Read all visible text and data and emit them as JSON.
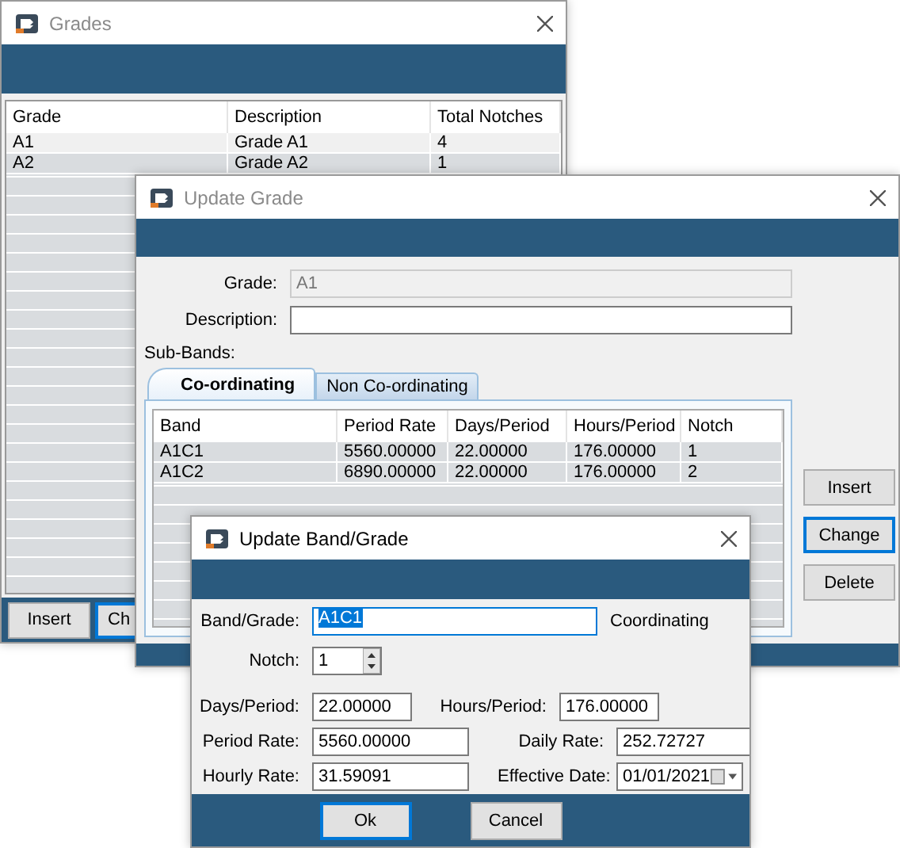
{
  "grades_window": {
    "title": "Grades",
    "columns": [
      "Grade",
      "Description",
      "Total Notches"
    ],
    "rows": [
      [
        "A1",
        "Grade A1",
        "4"
      ],
      [
        "A2",
        "Grade A2",
        "1"
      ]
    ],
    "buttons": [
      "Insert",
      "Ch"
    ]
  },
  "update_grade_window": {
    "title": "Update Grade",
    "fields": [
      {
        "label": "Grade:",
        "value": "A1",
        "disabled": true
      },
      {
        "label": "Description:",
        "disabled": false
      }
    ],
    "sub_bands_label": "Sub-Bands:",
    "tabs": [
      {
        "label": "Co-ordinating",
        "selected": true
      },
      {
        "label": "Non Co-ordinating",
        "selected": false
      }
    ],
    "columns": [
      "Band",
      "Period Rate",
      "Days/Period",
      "Hours/Period",
      "Notch"
    ],
    "rows": [
      [
        "A1C1",
        "5560.00000",
        "22.00000",
        "176.00000",
        "1"
      ],
      [
        "A1C2",
        "6890.00000",
        "22.00000",
        "176.00000",
        "2"
      ]
    ],
    "buttons": [
      {
        "label": "Insert",
        "focused": false
      },
      {
        "label": "Change",
        "focused": true
      },
      {
        "label": "Delete",
        "focused": false
      }
    ]
  },
  "band_window": {
    "title": "Update Band/Grade",
    "band_label": "Band/Grade:",
    "band_value": "A1C1",
    "band_type": "Coordinating",
    "notch_label": "Notch:",
    "notch_value": "1",
    "rows": [
      [
        {
          "label": "Days/Period:",
          "value": "22.00000"
        },
        {
          "label": "Hours/Period:",
          "value": "176.00000"
        }
      ],
      [
        {
          "label": "Period Rate:",
          "value": "5560.00000"
        },
        {
          "label": "Daily Rate:",
          "value": "252.72727"
        }
      ],
      [
        {
          "label": "Hourly Rate:",
          "value": "31.59091"
        },
        {
          "label": "Effective Date:",
          "value": "01/01/2021",
          "kind": "date"
        }
      ]
    ],
    "buttons": [
      {
        "label": "Ok",
        "focused": true
      },
      {
        "label": "Cancel",
        "focused": false
      }
    ]
  }
}
